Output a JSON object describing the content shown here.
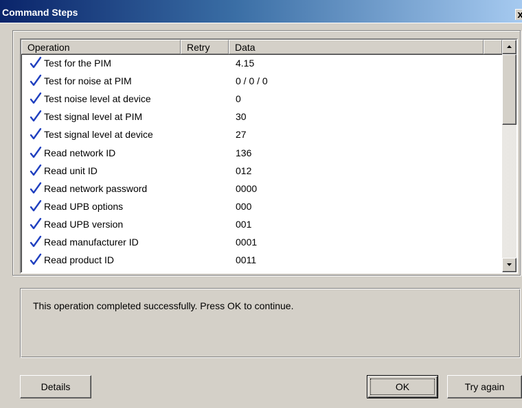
{
  "window": {
    "title": "Command Steps",
    "close_glyph": "x"
  },
  "list": {
    "columns": {
      "operation": "Operation",
      "retry": "Retry",
      "data": "Data"
    },
    "rows": [
      {
        "status_icon": "check-icon",
        "operation": "Test for the PIM",
        "retry": "",
        "data": "4.15"
      },
      {
        "status_icon": "check-icon",
        "operation": "Test for noise at PIM",
        "retry": "",
        "data": "0 / 0 / 0"
      },
      {
        "status_icon": "check-icon",
        "operation": "Test noise level at device",
        "retry": "",
        "data": "0"
      },
      {
        "status_icon": "check-icon",
        "operation": "Test signal level at PIM",
        "retry": "",
        "data": "30"
      },
      {
        "status_icon": "check-icon",
        "operation": "Test signal level at device",
        "retry": "",
        "data": "27"
      },
      {
        "status_icon": "check-icon",
        "operation": "Read network ID",
        "retry": "",
        "data": "136"
      },
      {
        "status_icon": "check-icon",
        "operation": "Read unit ID",
        "retry": "",
        "data": "012"
      },
      {
        "status_icon": "check-icon",
        "operation": "Read network password",
        "retry": "",
        "data": "0000"
      },
      {
        "status_icon": "check-icon",
        "operation": "Read UPB options",
        "retry": "",
        "data": "000"
      },
      {
        "status_icon": "check-icon",
        "operation": "Read UPB version",
        "retry": "",
        "data": "001"
      },
      {
        "status_icon": "check-icon",
        "operation": "Read manufacturer ID",
        "retry": "",
        "data": "0001"
      },
      {
        "status_icon": "check-icon",
        "operation": "Read product ID",
        "retry": "",
        "data": "0011"
      }
    ]
  },
  "message": "This operation completed successfully. Press OK to continue.",
  "buttons": {
    "details": "Details",
    "ok": "OK",
    "try_again": "Try again"
  },
  "colors": {
    "title_gradient_start": "#0a246a",
    "title_gradient_end": "#a6caf0",
    "check": "#1f3fbf",
    "face": "#d4d0c8"
  }
}
